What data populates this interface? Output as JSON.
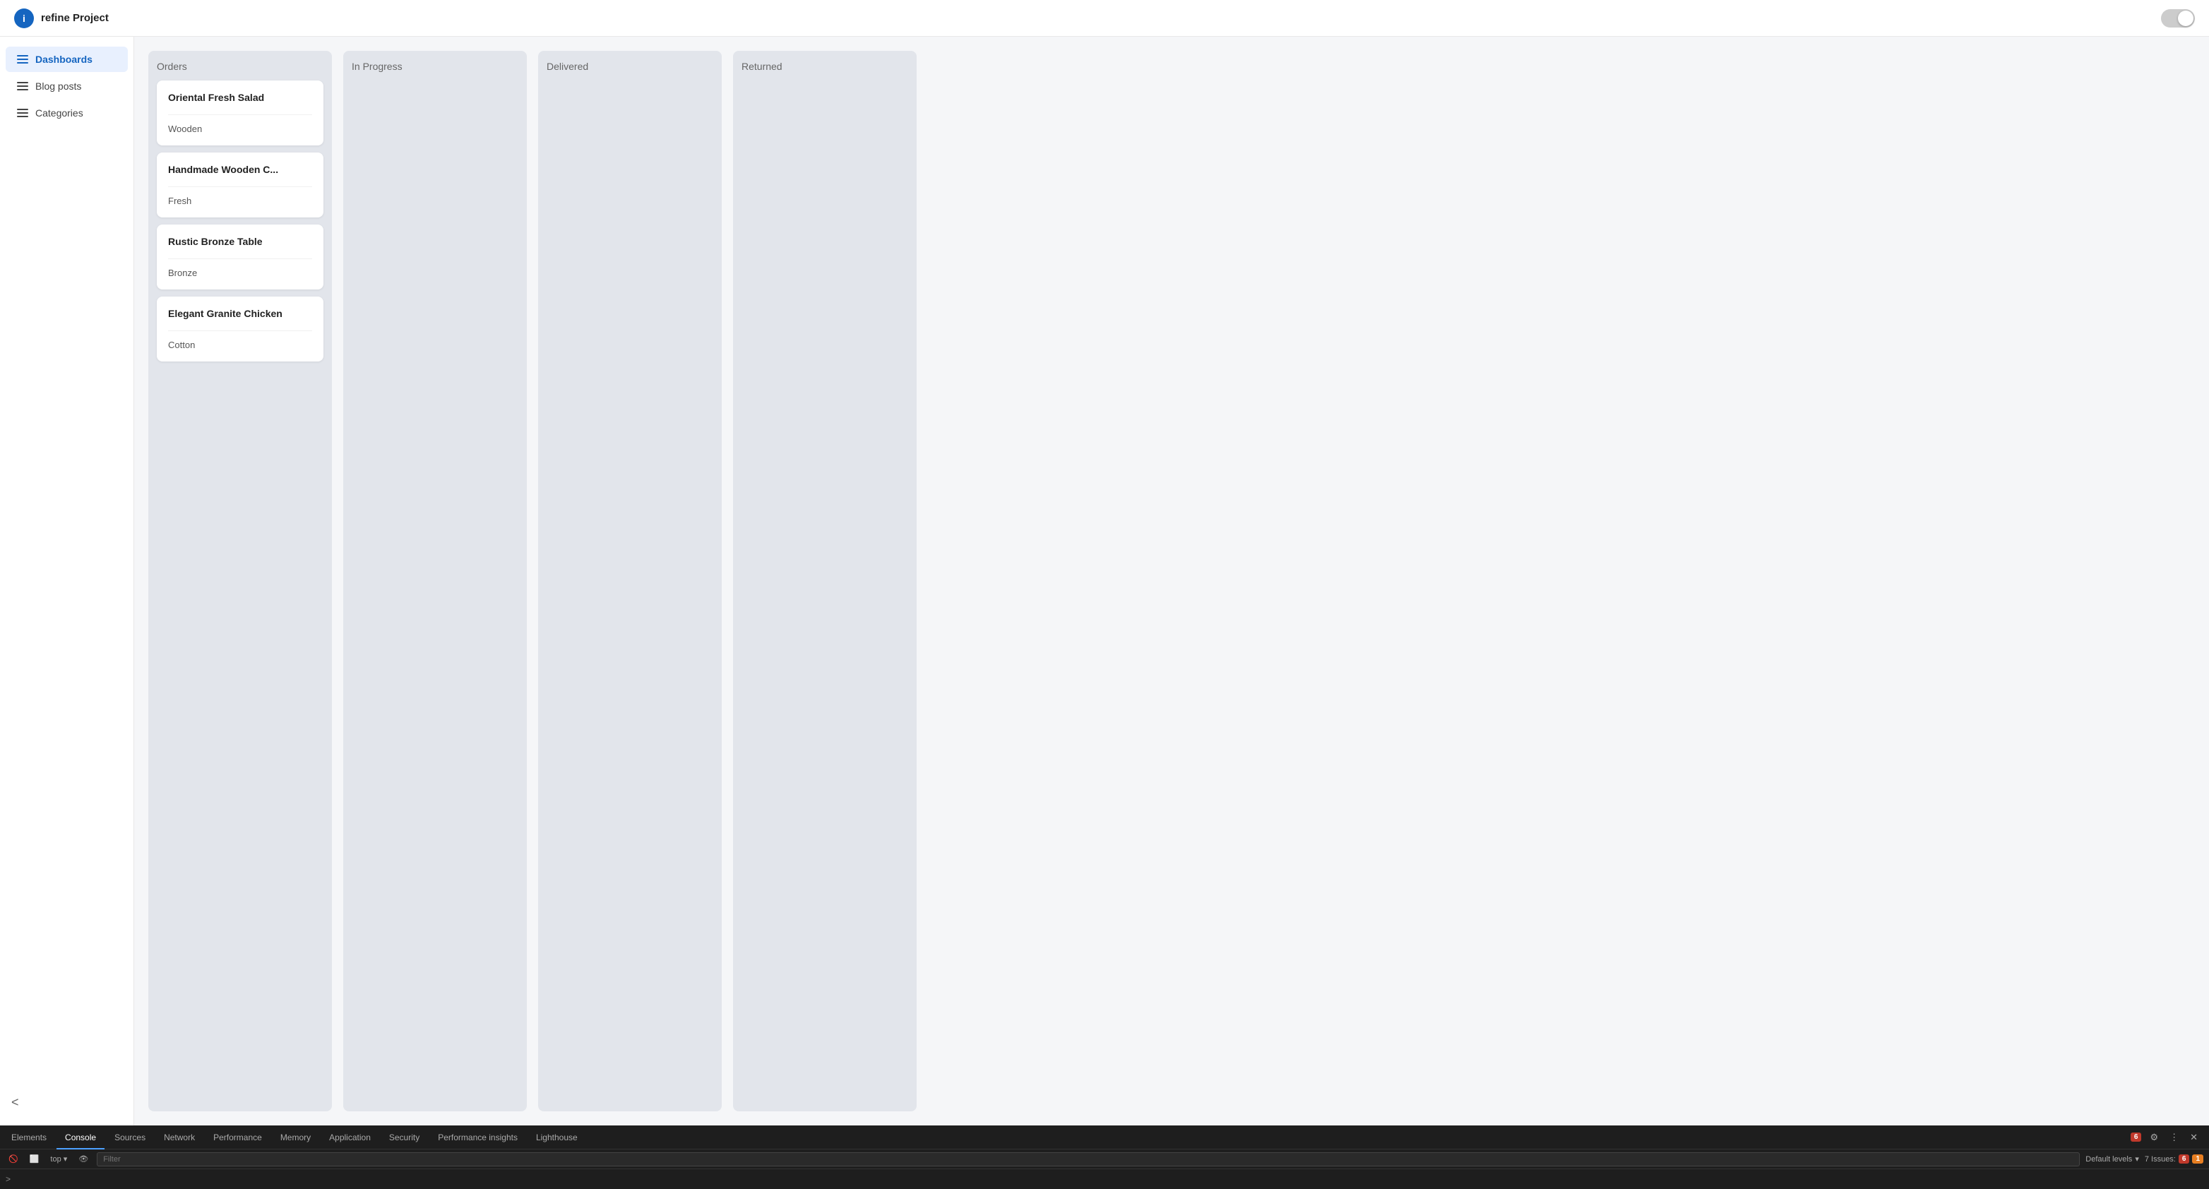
{
  "topbar": {
    "brand_icon_text": "i",
    "brand_title": "refine Project",
    "toggle_state": "off"
  },
  "sidebar": {
    "items": [
      {
        "id": "dashboards",
        "label": "Dashboards",
        "active": true
      },
      {
        "id": "blog-posts",
        "label": "Blog posts",
        "active": false
      },
      {
        "id": "categories",
        "label": "Categories",
        "active": false
      }
    ],
    "collapse_icon": "<"
  },
  "kanban": {
    "columns": [
      {
        "id": "orders",
        "title": "Orders",
        "cards": [
          {
            "title": "Oriental Fresh Salad",
            "subtitle": "Wooden"
          },
          {
            "title": "Handmade Wooden C...",
            "subtitle": "Fresh"
          },
          {
            "title": "Rustic Bronze Table",
            "subtitle": "Bronze"
          },
          {
            "title": "Elegant Granite Chicken",
            "subtitle": "Cotton"
          }
        ]
      },
      {
        "id": "in-progress",
        "title": "In Progress",
        "cards": []
      },
      {
        "id": "delivered",
        "title": "Delivered",
        "cards": []
      },
      {
        "id": "returned",
        "title": "Returned",
        "cards": []
      }
    ]
  },
  "devtools": {
    "tabs": [
      {
        "label": "Elements",
        "active": false
      },
      {
        "label": "Console",
        "active": true
      },
      {
        "label": "Sources",
        "active": false
      },
      {
        "label": "Network",
        "active": false
      },
      {
        "label": "Performance",
        "active": false
      },
      {
        "label": "Memory",
        "active": false
      },
      {
        "label": "Application",
        "active": false
      },
      {
        "label": "Security",
        "active": false
      },
      {
        "label": "Performance insights",
        "active": false
      },
      {
        "label": "Lighthouse",
        "active": false
      }
    ],
    "error_count": "6",
    "filter_placeholder": "Filter",
    "default_levels_label": "Default levels",
    "issues_label": "7 Issues:",
    "issues_error_count": "6",
    "issues_warning_count": "1",
    "top_label": "top",
    "prompt": ">"
  }
}
